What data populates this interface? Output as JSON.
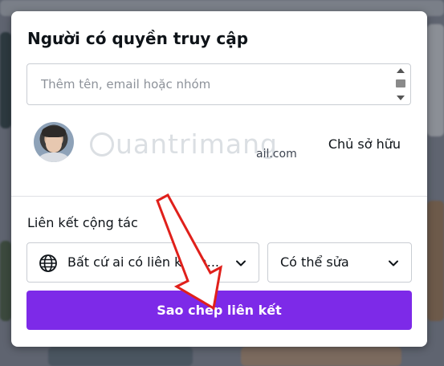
{
  "dialog": {
    "title": "Người có quyền truy cập",
    "search": {
      "placeholder": "Thêm tên, email hoặc nhóm",
      "value": ""
    },
    "user": {
      "email_fragment": "ail.com",
      "role": "Chủ sở hữu",
      "watermark": "uantrimang"
    },
    "collab": {
      "section_title": "Liên kết cộng tác",
      "access_select": {
        "selected": "Bất cứ ai có liên kết n..."
      },
      "permission_select": {
        "selected": "Có thể sửa"
      },
      "copy_button_label": "Sao chép liên kết"
    }
  },
  "colors": {
    "accent": "#7d2ae8",
    "annotation_arrow": "#e0201b"
  },
  "icons": [
    "scroll-up-icon",
    "scroll-down-icon",
    "globe-icon",
    "chevron-down-icon",
    "lightbulb-icon"
  ]
}
